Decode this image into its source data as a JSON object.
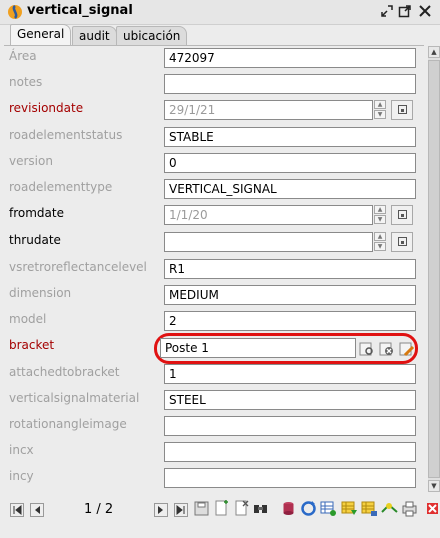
{
  "window": {
    "title": "vertical_signal"
  },
  "tabs": [
    {
      "label": "General",
      "active": true
    },
    {
      "label": "audit",
      "active": false
    },
    {
      "label": "ubicación",
      "active": false
    }
  ],
  "fields": {
    "area": {
      "label": "Área",
      "value": "472097"
    },
    "notes": {
      "label": "notes",
      "value": ""
    },
    "revisiondate": {
      "label": "revisiondate",
      "value": "29/1/21"
    },
    "roadelementstatus": {
      "label": "roadelementstatus",
      "value": "STABLE"
    },
    "version": {
      "label": "version",
      "value": "0"
    },
    "roadelementtype": {
      "label": "roadelementtype",
      "value": "VERTICAL_SIGNAL"
    },
    "fromdate": {
      "label": "fromdate",
      "value": "1/1/20"
    },
    "thrudate": {
      "label": "thrudate",
      "value": ""
    },
    "vsretroreflectancelevel": {
      "label": "vsretroreflectancelevel",
      "value": "R1"
    },
    "dimension": {
      "label": "dimension",
      "value": "MEDIUM"
    },
    "model": {
      "label": "model",
      "value": "2"
    },
    "bracket": {
      "label": "bracket",
      "value": "Poste 1"
    },
    "attachedtobracket": {
      "label": "attachedtobracket",
      "value": "1"
    },
    "verticalsignalmaterial": {
      "label": "verticalsignalmaterial",
      "value": "STEEL"
    },
    "rotationangleimage": {
      "label": "rotationangleimage",
      "value": ""
    },
    "incx": {
      "label": "incx",
      "value": ""
    },
    "incy": {
      "label": "incy",
      "value": ""
    }
  },
  "navigation": {
    "page_info": "1 / 2"
  },
  "colors": {
    "required_label": "#a40000",
    "disabled_label": "#a0a0a0",
    "highlight": "#e01212"
  }
}
